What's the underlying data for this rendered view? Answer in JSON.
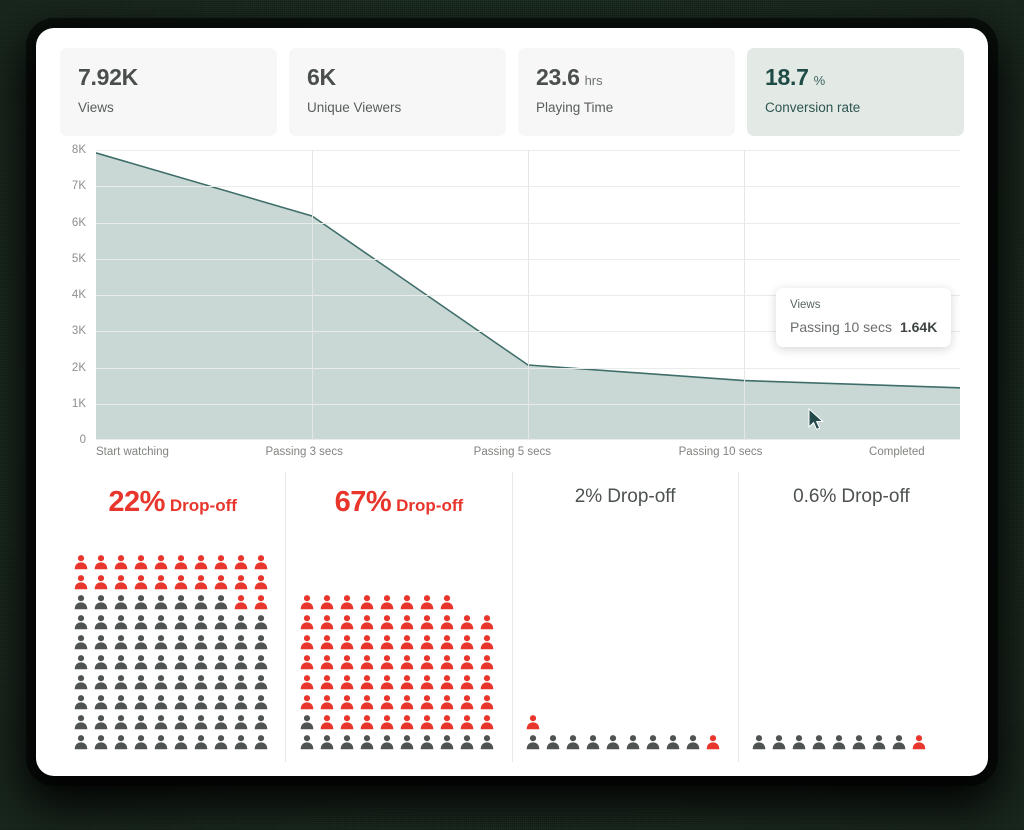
{
  "stats": [
    {
      "value": "7.92K",
      "unit": "",
      "label": "Views",
      "accent": false
    },
    {
      "value": "6K",
      "unit": "",
      "label": "Unique Viewers",
      "accent": false
    },
    {
      "value": "23.6",
      "unit": "hrs",
      "label": "Playing Time",
      "accent": false
    },
    {
      "value": "18.7",
      "unit": "%",
      "label": "Conversion rate",
      "accent": true
    }
  ],
  "chart_data": {
    "type": "area",
    "title": "",
    "xlabel": "",
    "ylabel": "Views",
    "categories": [
      "Start watching",
      "Passing 3 secs",
      "Passing 5 secs",
      "Passing 10 secs",
      "Completed"
    ],
    "values": [
      7920,
      6180,
      2070,
      1640,
      1440
    ],
    "value_labels": [
      "7.92K",
      "6.18K",
      "2.07K",
      "1.64K",
      "1.44K"
    ],
    "yticks": [
      "0",
      "1K",
      "2K",
      "3K",
      "4K",
      "5K",
      "6K",
      "7K",
      "8K"
    ],
    "ytick_values": [
      0,
      1000,
      2000,
      3000,
      4000,
      5000,
      6000,
      7000,
      8000
    ],
    "ylim": [
      0,
      8000
    ],
    "grid": true,
    "legend": "none",
    "series": [
      {
        "name": "Views",
        "values": [
          7920,
          6180,
          2070,
          1640,
          1440
        ]
      }
    ],
    "area_fill_color": "#c9d8d5",
    "line_color": "#3f6e6a",
    "hovered_category": "Passing 10 secs"
  },
  "tooltip": {
    "header": "Views",
    "label": "Passing 10 secs",
    "value": "1.64K"
  },
  "dropoffs": [
    {
      "pct": "22%",
      "word": "Drop-off",
      "emphasis": true,
      "rows": [
        {
          "count": 10,
          "red": 10
        },
        {
          "count": 10,
          "red": 10
        },
        {
          "count": 10,
          "red": 0,
          "red_right": 2
        },
        {
          "count": 10,
          "red": 0
        },
        {
          "count": 10,
          "red": 0
        },
        {
          "count": 10,
          "red": 0
        },
        {
          "count": 10,
          "red": 0
        },
        {
          "count": 10,
          "red": 0
        },
        {
          "count": 10,
          "red": 0
        },
        {
          "count": 10,
          "red": 0
        }
      ]
    },
    {
      "pct": "67%",
      "word": "Drop-off",
      "emphasis": true,
      "rows": [
        {
          "count": 8,
          "red": 8
        },
        {
          "count": 10,
          "red": 10
        },
        {
          "count": 10,
          "red": 10
        },
        {
          "count": 10,
          "red": 10
        },
        {
          "count": 10,
          "red": 10
        },
        {
          "count": 10,
          "red": 10
        },
        {
          "count": 10,
          "red": 0,
          "red_right": 9
        },
        {
          "count": 10,
          "red": 0
        }
      ]
    },
    {
      "pct": "2%",
      "word": "Drop-off",
      "emphasis": false,
      "rows": [
        {
          "count": 1,
          "red": 1
        },
        {
          "count": 10,
          "red": 0,
          "red_right": 1
        }
      ]
    },
    {
      "pct": "0.6%",
      "word": "Drop-off",
      "emphasis": false,
      "rows": [
        {
          "count": 9,
          "red": 0,
          "red_right": 1
        }
      ]
    }
  ],
  "colors": {
    "red": "#e8362c",
    "gray": "#4f5452",
    "accent_card_bg": "#e3eae5",
    "accent_text": "#1e4b46",
    "area_fill": "#c9d8d5",
    "line": "#3f6e6a",
    "page_bg": "#3f5c48"
  }
}
